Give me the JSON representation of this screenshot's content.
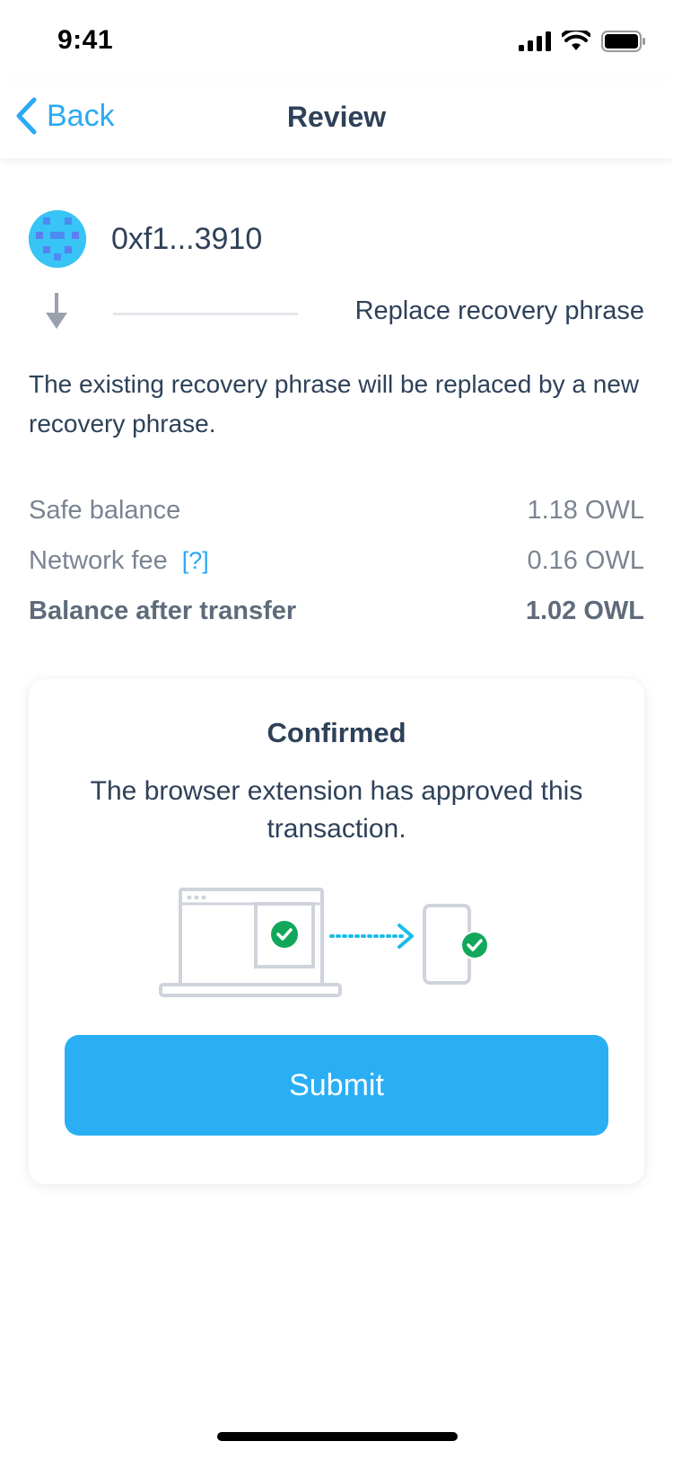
{
  "status_bar": {
    "time": "9:41"
  },
  "nav": {
    "back_label": "Back",
    "title": "Review"
  },
  "account": {
    "address": "0xf1...3910"
  },
  "action": {
    "label": "Replace recovery phrase"
  },
  "description": "The existing recovery phrase will be replaced by a new recovery phrase.",
  "balances": {
    "safe_balance_label": "Safe balance",
    "safe_balance_value": "1.18 OWL",
    "network_fee_label": "Network fee",
    "network_fee_help": "[?]",
    "network_fee_value": "0.16 OWL",
    "after_label": "Balance after transfer",
    "after_value": "1.02 OWL"
  },
  "card": {
    "title": "Confirmed",
    "text": "The browser extension has approved this transaction.",
    "submit_label": "Submit"
  },
  "colors": {
    "accent": "#2aaff5",
    "check_green": "#12a85b",
    "text": "#2e4159"
  }
}
